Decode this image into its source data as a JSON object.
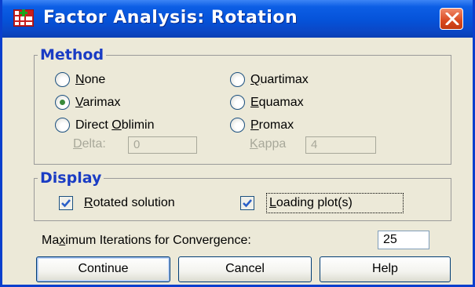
{
  "window": {
    "title": "Factor Analysis: Rotation"
  },
  "method": {
    "legend": "Method",
    "options": [
      {
        "key": "N",
        "rest": "one",
        "checked": false
      },
      {
        "key": "Q",
        "rest": "uartimax",
        "checked": false
      },
      {
        "key": "V",
        "rest": "arimax",
        "checked": true
      },
      {
        "key": "E",
        "rest": "quamax",
        "checked": false
      },
      {
        "pre": "Direct ",
        "key": "O",
        "rest": "blimin",
        "checked": false
      },
      {
        "key": "P",
        "rest": "romax",
        "checked": false
      }
    ],
    "delta": {
      "key": "D",
      "rest": "elta:",
      "value": "0"
    },
    "kappa": {
      "key": "K",
      "rest": "appa",
      "value": "4"
    }
  },
  "display": {
    "legend": "Display",
    "rotated": {
      "key": "R",
      "rest": "otated solution",
      "checked": true
    },
    "loading": {
      "key": "L",
      "rest": "oading plot(s)",
      "checked": true
    }
  },
  "iterations": {
    "pre": "Ma",
    "key": "x",
    "rest": "imum Iterations for Convergence:",
    "value": "25"
  },
  "buttons": {
    "continue": "Continue",
    "cancel": "Cancel",
    "help": "Help"
  },
  "colors": {
    "legend": "#1a3cc4",
    "titlebar": "#0552d8",
    "close": "#d9481f",
    "check": "#2a5fc8",
    "radio_dot": "#3a8a3a"
  }
}
